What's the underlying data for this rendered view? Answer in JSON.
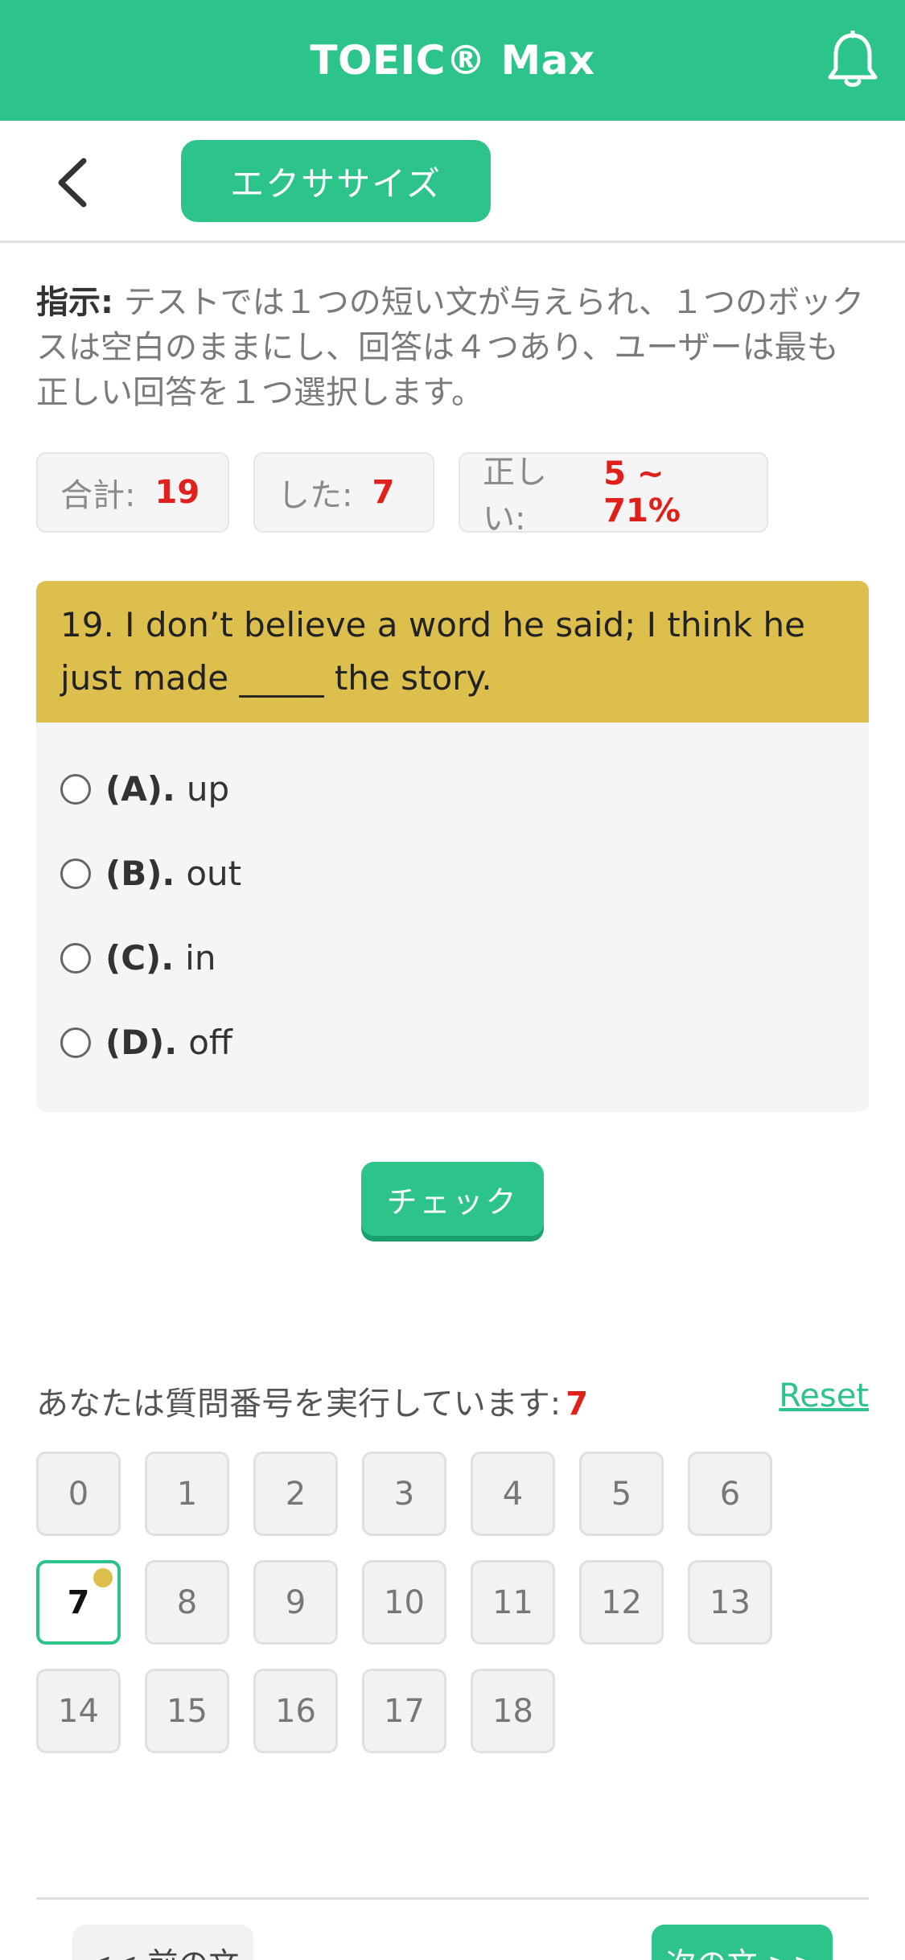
{
  "header": {
    "title": "TOEIC® Max",
    "bell_icon": "bell-icon"
  },
  "subbar": {
    "back_icon": "chevron-left-icon",
    "tab_label": "エクササイズ"
  },
  "instruction": {
    "label": "指示:",
    "text": " テストでは１つの短い文が与えられ、１つのボックスは空白のままにし、回答は４つあり、ユーザーは最も正しい回答を１つ選択します。"
  },
  "stats": {
    "total_label": "合計:",
    "total_value": "19",
    "done_label": "した:",
    "done_value": "7",
    "correct_label": "正しい:",
    "correct_value": "5 ~ 71%"
  },
  "question": {
    "text": "19. I don’t believe a word he said; I think he just made _____ the story.",
    "options": [
      {
        "key": "(A).",
        "text": "up"
      },
      {
        "key": "(B).",
        "text": "out"
      },
      {
        "key": "(C).",
        "text": "in"
      },
      {
        "key": "(D).",
        "text": "off"
      }
    ]
  },
  "check_label": "チェック",
  "progress": {
    "label": "あなたは質問番号を実行しています:",
    "current": "7",
    "reset_label": "Reset"
  },
  "question_numbers": [
    "0",
    "1",
    "2",
    "3",
    "4",
    "5",
    "6",
    "7",
    "8",
    "9",
    "10",
    "11",
    "12",
    "13",
    "14",
    "15",
    "16",
    "17",
    "18"
  ],
  "active_number": "7",
  "nav": {
    "prev_label": "<< 前の文",
    "next_label": "次の文 >>"
  },
  "colors": {
    "brand": "#2dc48b",
    "question_header": "#dcbf4c",
    "highlight": "#e0201b"
  }
}
